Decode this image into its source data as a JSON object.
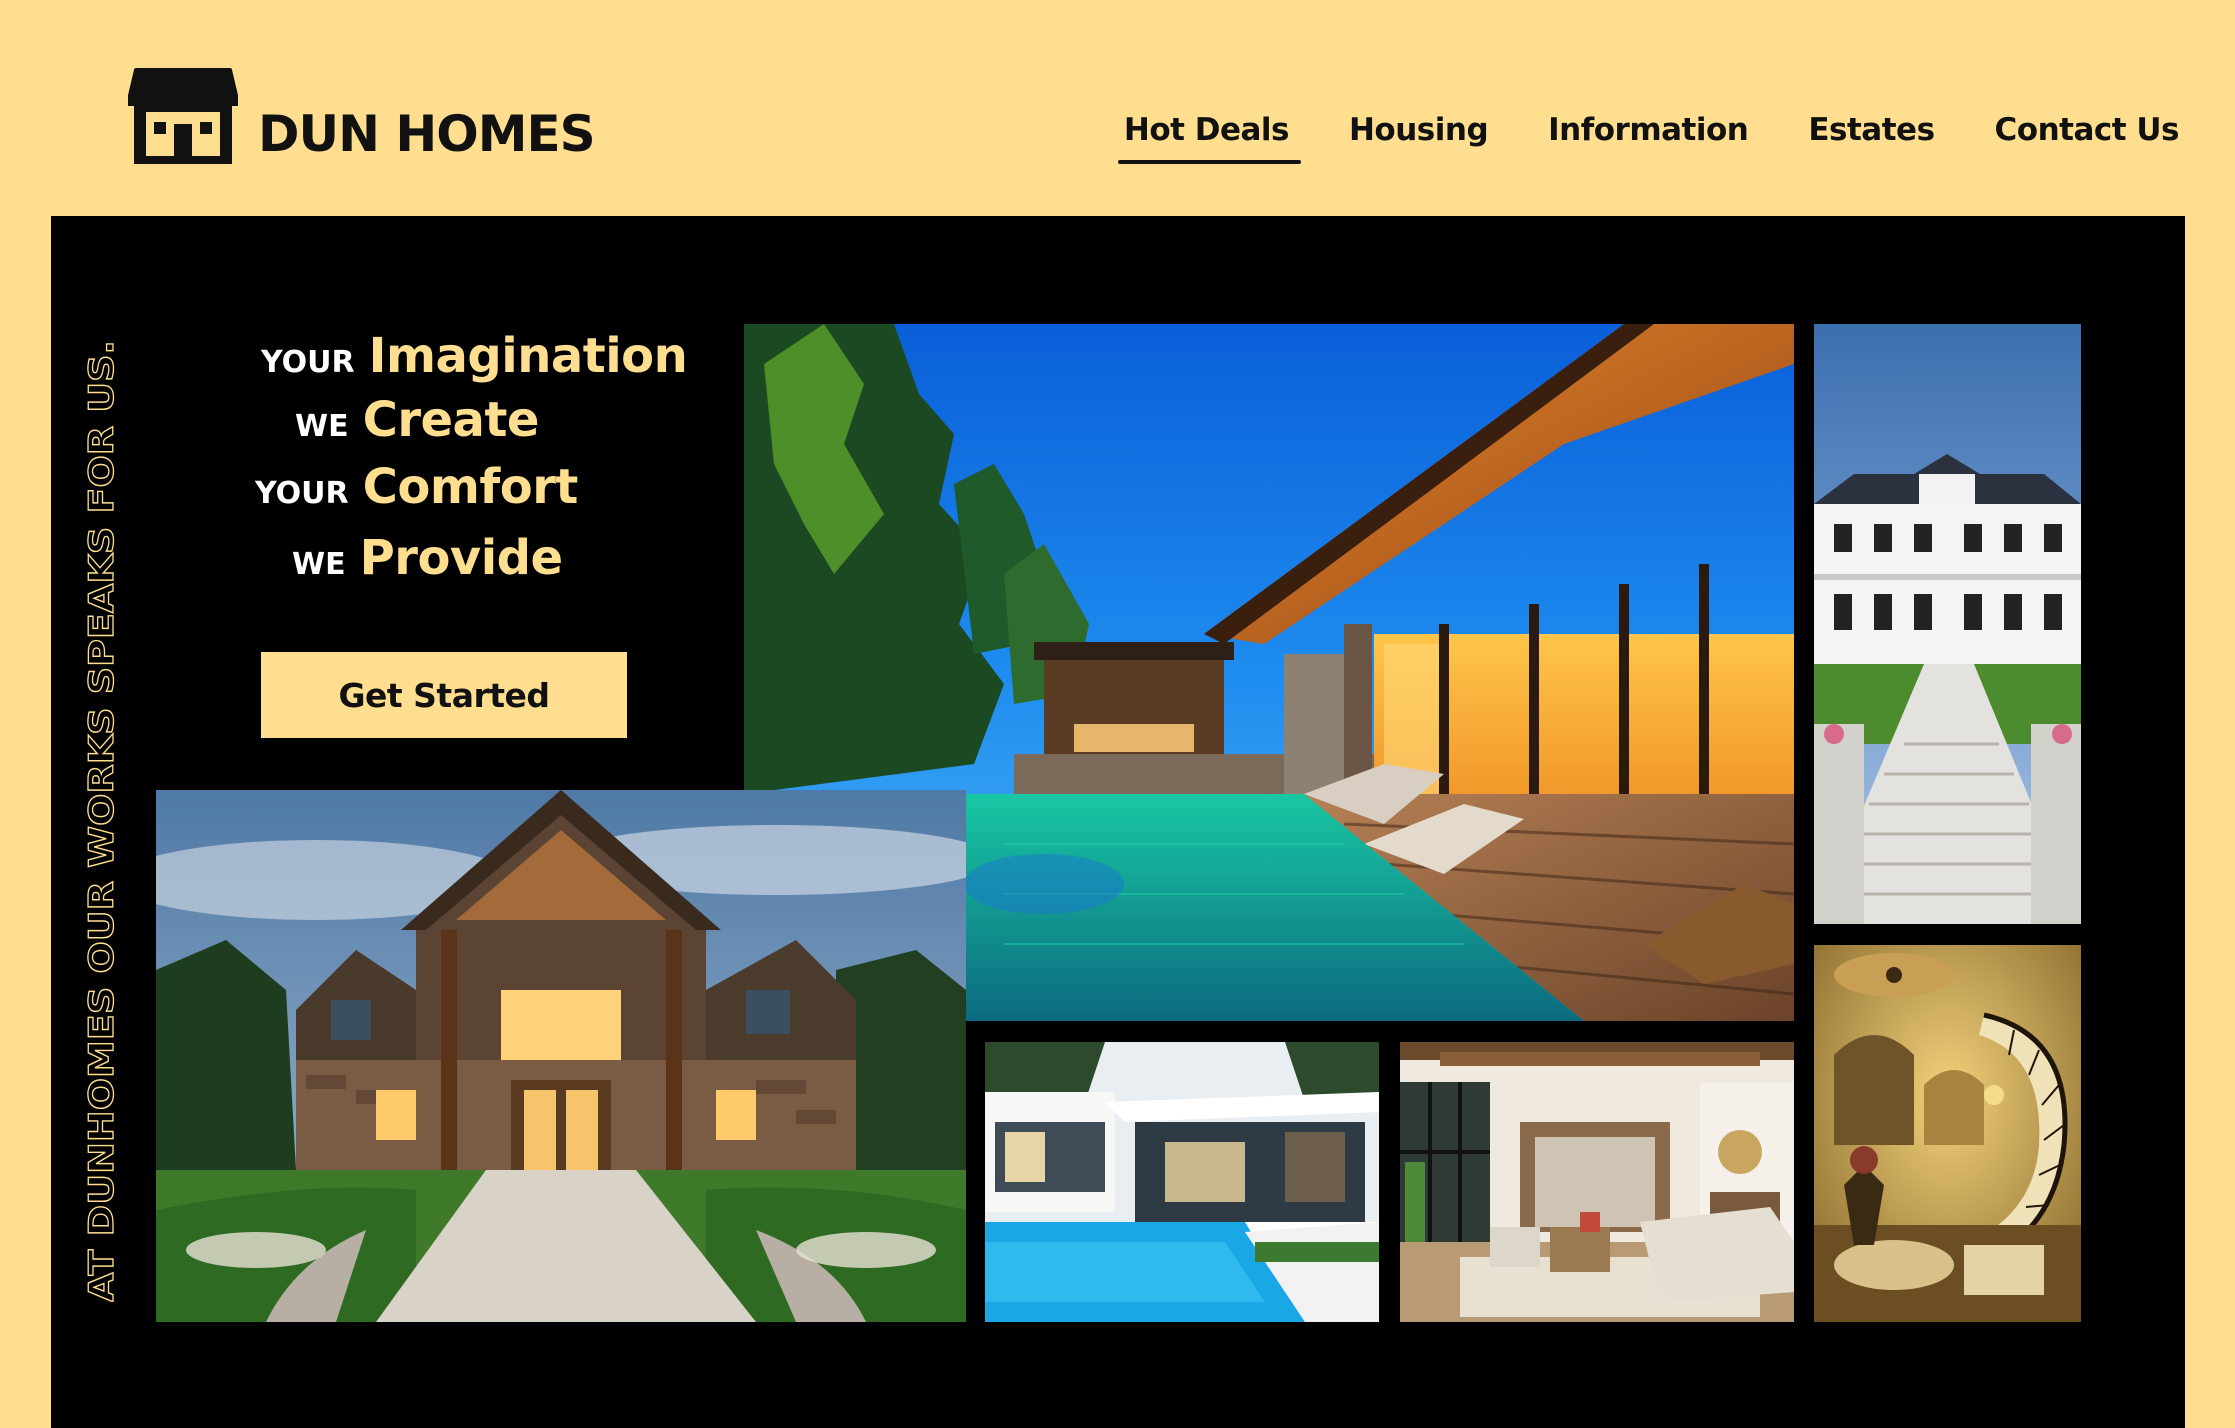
{
  "brand": {
    "name": "DUN HOMES"
  },
  "nav": {
    "items": [
      {
        "label": "Hot Deals",
        "active": true
      },
      {
        "label": "Housing",
        "active": false
      },
      {
        "label": "Information",
        "active": false
      },
      {
        "label": "Estates",
        "active": false
      },
      {
        "label": "Contact Us",
        "active": false
      }
    ]
  },
  "hero": {
    "tagline": "AT DUNHOMES OUR WORKS SPEAKS FOR US.",
    "headline": [
      {
        "small": "YOUR",
        "big": "Imagination"
      },
      {
        "small": "WE",
        "big": "Create"
      },
      {
        "small": "YOUR",
        "big": "Comfort"
      },
      {
        "small": "WE",
        "big": "Provide"
      }
    ],
    "cta_label": "Get Started"
  },
  "colors": {
    "accent": "#FFDF8F",
    "dark": "#000000",
    "text": "#111111"
  },
  "photos": [
    {
      "name": "modern-pool-house-dusk"
    },
    {
      "name": "white-mansion-staircase"
    },
    {
      "name": "craftsman-stone-house"
    },
    {
      "name": "modern-white-pool-house"
    },
    {
      "name": "open-plan-living-room"
    },
    {
      "name": "grand-spiral-staircase-interior"
    }
  ]
}
